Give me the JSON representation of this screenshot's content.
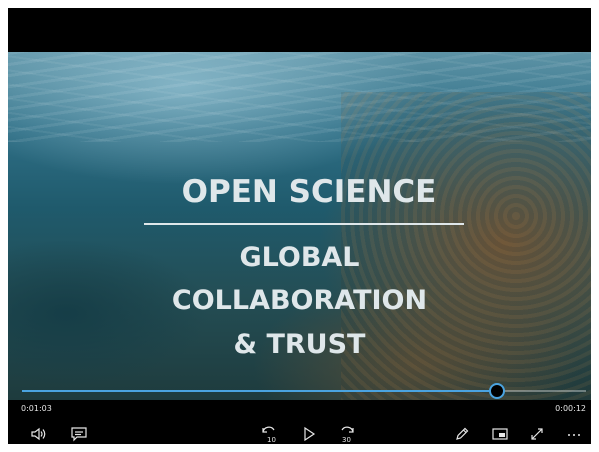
{
  "video": {
    "title_main": "OPEN SCIENCE",
    "title_line1": "GLOBAL",
    "title_line2": "COLLABORATION",
    "title_line3": "& TRUST"
  },
  "playback": {
    "elapsed": "0:01:03",
    "remaining": "0:00:12",
    "progress": 0.84
  },
  "controls": {
    "skip_back_seconds": "10",
    "skip_forward_seconds": "30",
    "accent_color": "#4aa3df"
  }
}
